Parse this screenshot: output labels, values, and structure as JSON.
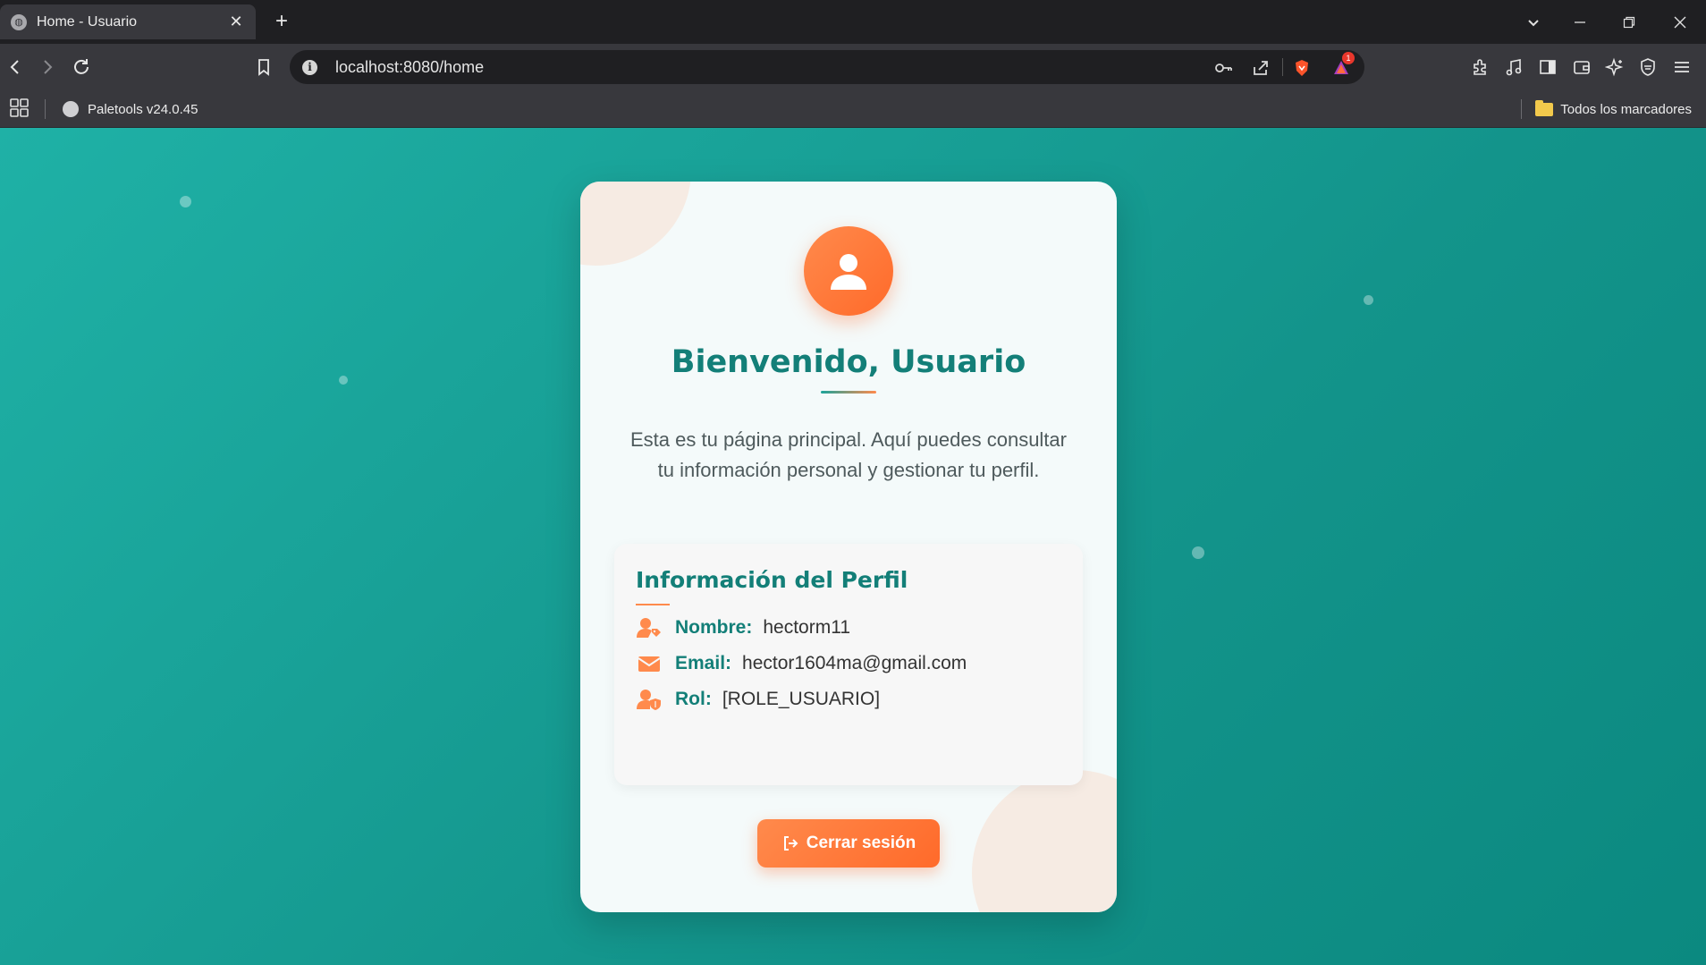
{
  "browser": {
    "tab_title": "Home - Usuario",
    "url": "localhost:8080/home",
    "notification_count": "1",
    "bookmarks": {
      "item": "Paletools v24.0.45",
      "all": "Todos los marcadores"
    }
  },
  "colors": {
    "accent_teal": "#137f78",
    "accent_orange": "#ff7a3a",
    "page_background": "#17a096"
  },
  "card": {
    "welcome": "Bienvenido, Usuario",
    "intro": "Esta es tu página principal. Aquí puedes consultar tu información personal y gestionar tu perfil.",
    "profile": {
      "title": "Información del Perfil",
      "name_label": "Nombre:",
      "name_value": "hectorm11",
      "email_label": "Email:",
      "email_value": "hector1604ma@gmail.com",
      "role_label": "Rol:",
      "role_value": "[ROLE_USUARIO]"
    },
    "logout_label": "Cerrar sesión"
  }
}
